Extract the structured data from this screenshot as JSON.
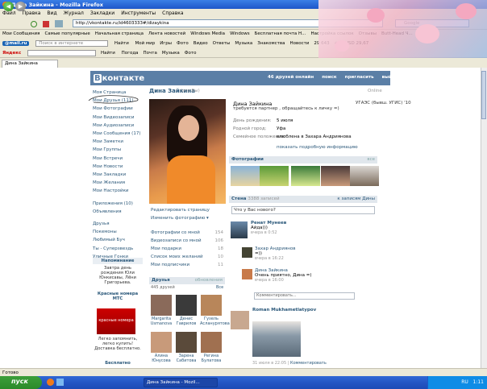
{
  "window": {
    "title": "Дина Зайкина - Mozilla Firefox"
  },
  "menu": [
    "Файл",
    "Правка",
    "Вид",
    "Журнал",
    "Закладки",
    "Инструменты",
    "Справка"
  ],
  "nav": {
    "url": "http://vkontakte.ru/id4603333#/dizaykina",
    "search_placeholder": "Google"
  },
  "bookmarks1": [
    "Мои Сообщения",
    "Самые популярные",
    "Начальная страница",
    "Лента новостей",
    "Windows Media",
    "Windows",
    "Бесплатная почта Н...",
    "Настройка ссылок",
    "Отзывы",
    "Butt-Head Ч..."
  ],
  "bookmarks2": {
    "mail": "@mail.ru",
    "search": "Поиск в интернете",
    "find": "Найти",
    "items": [
      "Мой мир",
      "Игры",
      "Фото",
      "Видео",
      "Ответы",
      "Музыка",
      "Знакомства",
      "Новости"
    ],
    "count": "29 643",
    "rate": "+15 USD 29,67"
  },
  "bookmarks3": {
    "yandex": "Яндекс",
    "find": "Найти",
    "items": [
      "Погода",
      "Почта",
      "Музыка",
      "Фото"
    ]
  },
  "tab": "Дина Зайкина",
  "vk": {
    "logo_b": "В",
    "logo_rest": "контакте",
    "topnav": [
      "46 друзей онлайн",
      "поиск",
      "пригласить",
      "выйти"
    ],
    "leftmenu": [
      "Моя Страница",
      "Мои Друзья (111)",
      "Мои Фотографии",
      "Мои Видеозаписи",
      "Мои Аудиозаписи",
      "Мои Сообщения (17)",
      "Мои Заметки",
      "Мои Группы",
      "Мои Встречи",
      "Мои Новости",
      "Мои Закладки",
      "Мои Желания",
      "Мои Настройки",
      "",
      "Приложения (10)",
      "Объявления",
      "",
      "Друзья",
      "Покемоны",
      "Любимый Буч",
      "Ты - Суперзвездь",
      "Уличные Гонки"
    ],
    "reminder": {
      "title": "Напоминание",
      "text": "Завтра день рождения Юли Юнкисавы, Лёни Григорьева."
    },
    "mts": {
      "title": "Красные номера МТС",
      "img": "красные номера",
      "text": "Легко запомнить, легко купить! Доставка бесплатно."
    },
    "ad_bottom": "Бесплатно",
    "profile": {
      "name": "Дина Зайкина",
      "you": "(это Вы)",
      "online": "Online",
      "status": "требуется партнер , обращайтесь к личку =)",
      "school": "УГАЭС (бывш. УГИС) '10",
      "rows": [
        {
          "k": "День рождения:",
          "v": "5 июля"
        },
        {
          "k": "Родной город:",
          "v": "Уфа"
        },
        {
          "k": "Семейное положение:",
          "v": "влюблена в Захара Андриянова"
        }
      ],
      "showinfo": "показать подробную информацию"
    },
    "actions": [
      "Редактировать страницу",
      "Изменить фотографию ▾"
    ],
    "counts": [
      {
        "label": "Фотографии со мной",
        "n": "154"
      },
      {
        "label": "Видеозаписи со мной",
        "n": "106"
      },
      {
        "label": "Мои подарки",
        "n": "18"
      },
      {
        "label": "Список моих желаний",
        "n": "10"
      },
      {
        "label": "Мои подписчики",
        "n": "11"
      }
    ],
    "friends": {
      "title": "Друзья",
      "edit": "обновления",
      "count": "445 друзей",
      "all": "Все",
      "list": [
        {
          "name": "Margarita Usmanova",
          "c": "#8a6a5a"
        },
        {
          "name": "Денис Гаврилов",
          "c": "#3a3a3a"
        },
        {
          "name": "Гузель Асланурятова",
          "c": "#b8865a"
        },
        {
          "name": "Алина Юнусова",
          "c": "#c89a7a"
        },
        {
          "name": "Зарена Сабитова",
          "c": "#5a4a3a"
        },
        {
          "name": "Регина Булатова",
          "c": "#a07050"
        }
      ]
    },
    "photos": {
      "title": "Фотографии",
      "all": "все"
    },
    "wall": {
      "title": "Стена",
      "count": "3388 записей",
      "to": "к записям Дины",
      "placeholder": "Что у Вас нового?"
    },
    "posts": [
      {
        "name": "Ренат Мунеев",
        "text": "Айда)))",
        "date": "вчера в 0:52"
      },
      {
        "name": "Захар Андриянов",
        "text": "=))",
        "date": "вчера в 16:22"
      },
      {
        "name": "Дина Зайкина",
        "text": "Очень приятно, Дина =)",
        "date": "вчера в 16:00"
      }
    ],
    "comment_ph": "Комментировать...",
    "post2": {
      "name": "Roman Mukhametlatypov",
      "date": "31 июля в 22:05",
      "comment": "Комментировать"
    }
  },
  "statusbar": "Готово",
  "taskbar": {
    "start": "пуск",
    "item": "Дина Зайкина - Mozil...",
    "lang": "RU",
    "time": "1:11"
  }
}
